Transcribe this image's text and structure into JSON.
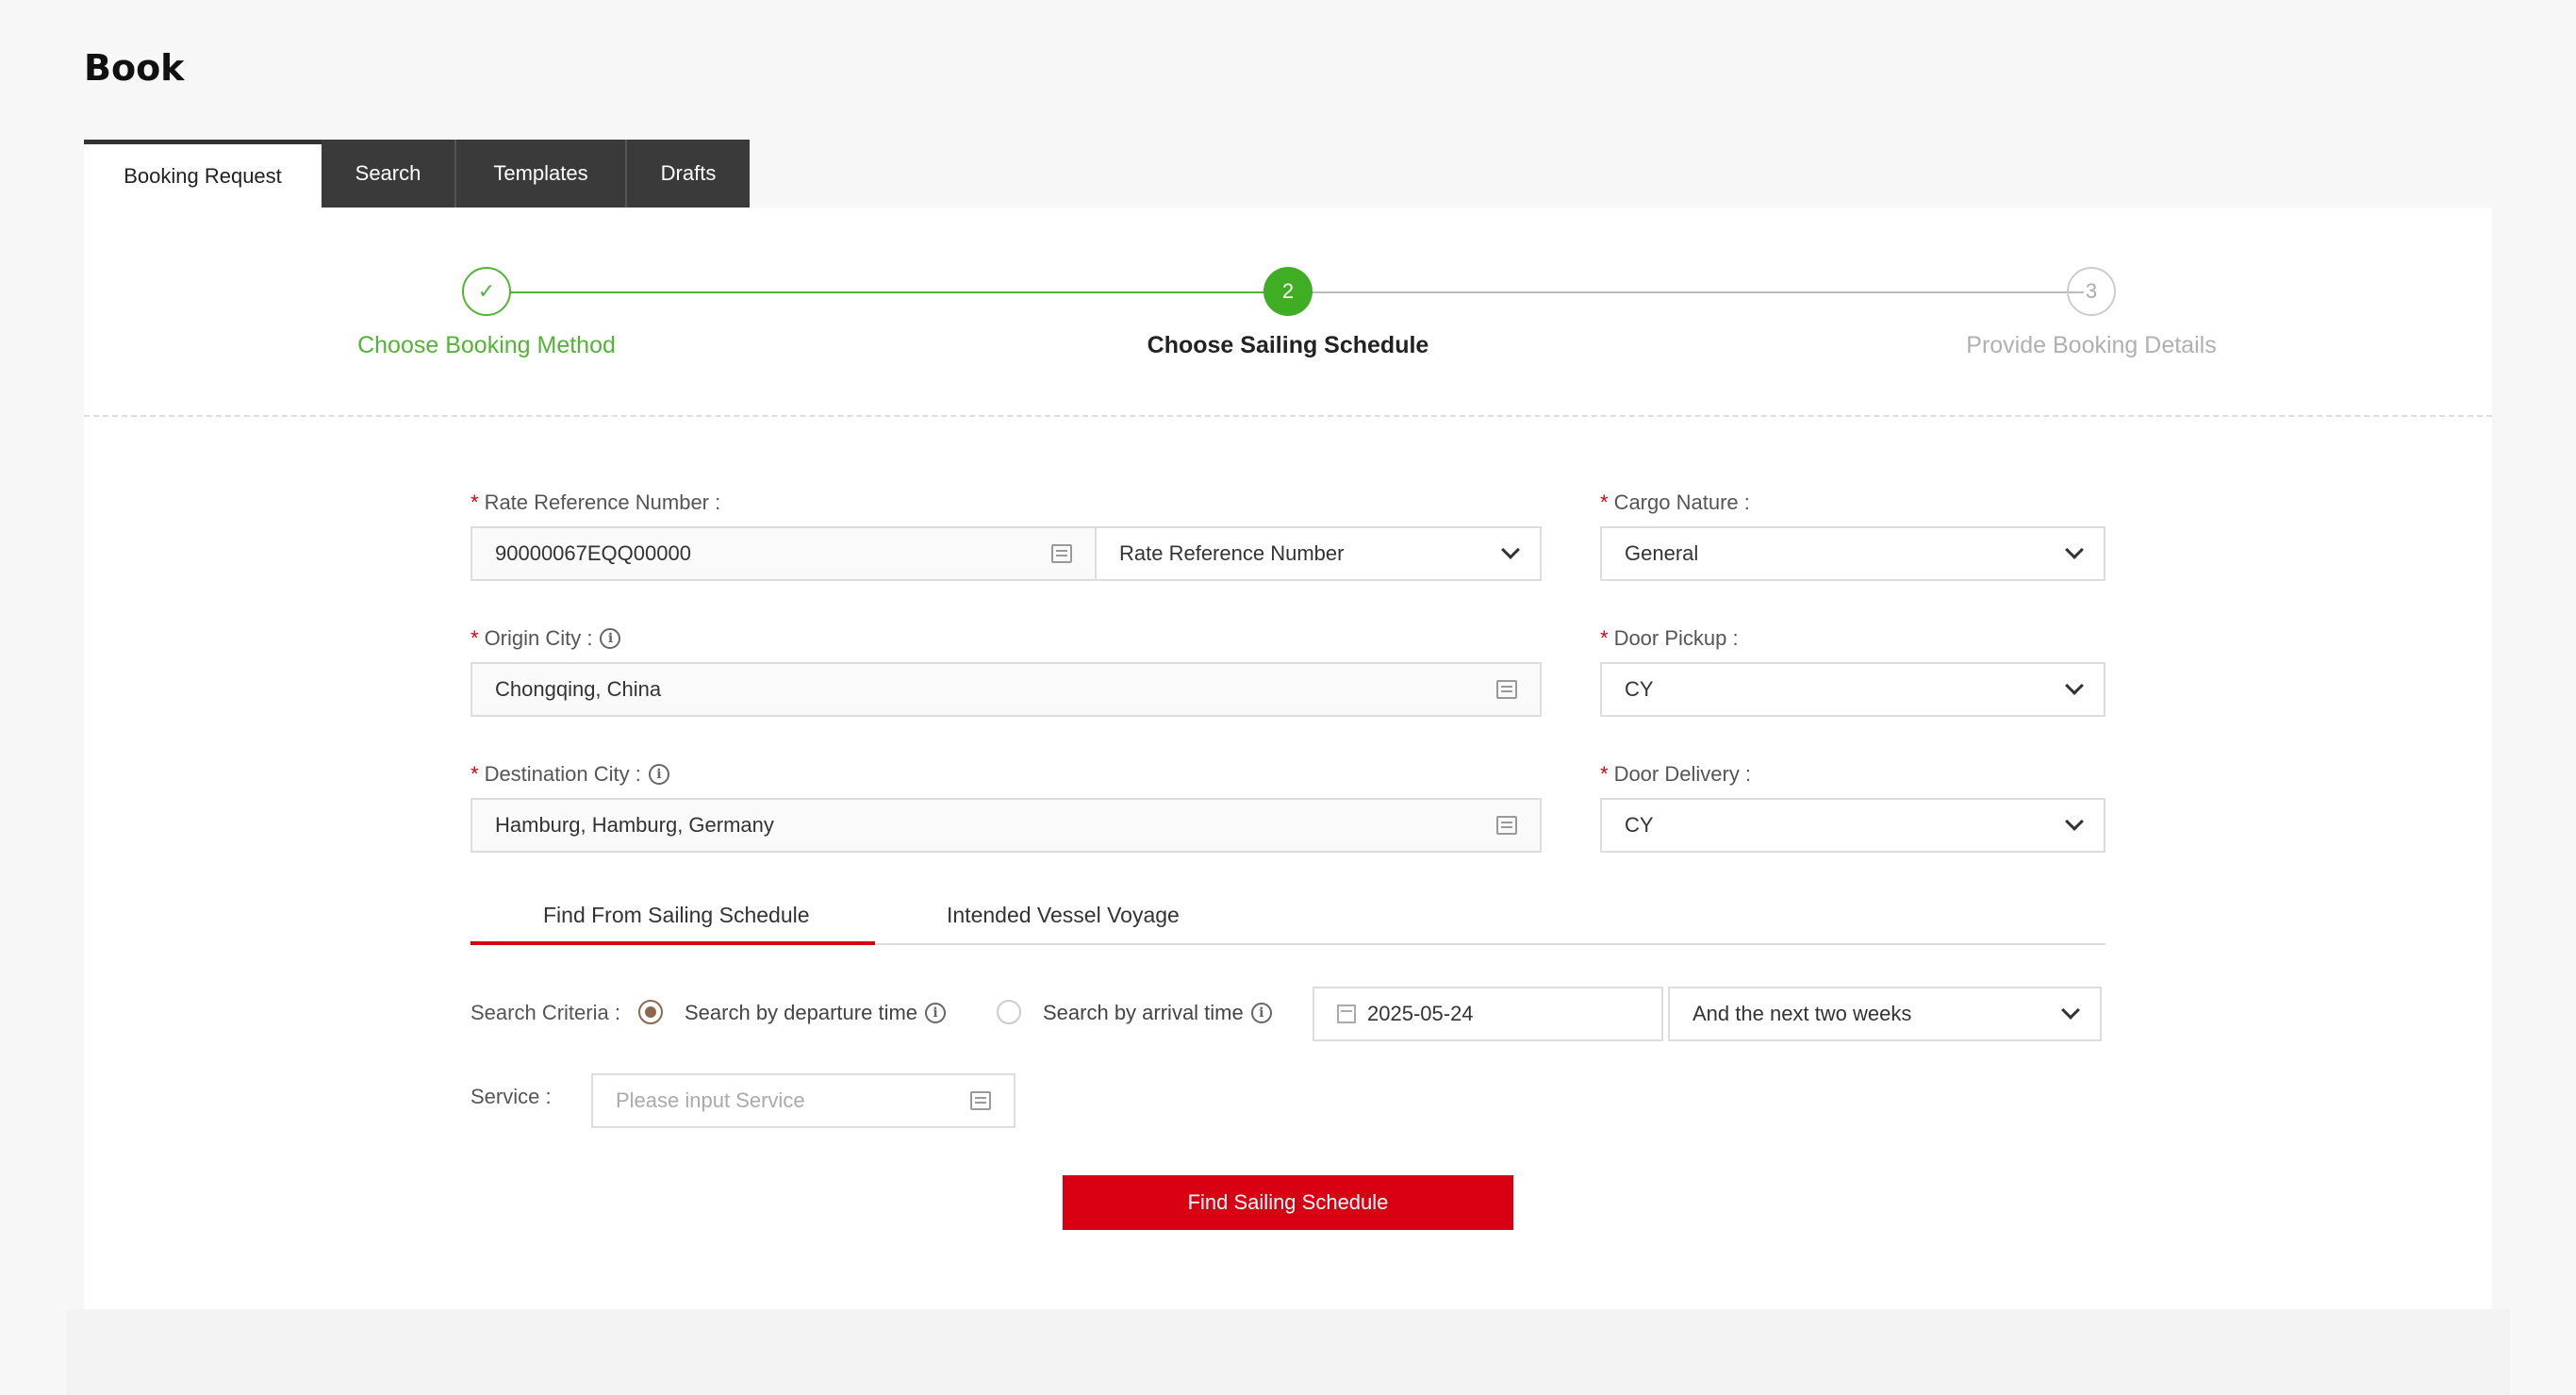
{
  "page": {
    "title": "Book"
  },
  "tabs": [
    {
      "label": "Booking Request"
    },
    {
      "label": "Search"
    },
    {
      "label": "Templates"
    },
    {
      "label": "Drafts"
    }
  ],
  "stepper": {
    "steps": [
      {
        "num": "✓",
        "label": "Choose Booking Method",
        "state": "done"
      },
      {
        "num": "2",
        "label": "Choose Sailing Schedule",
        "state": "active"
      },
      {
        "num": "3",
        "label": "Provide Booking Details",
        "state": "pending"
      }
    ]
  },
  "form": {
    "required_mark": "*",
    "rate_ref": {
      "label": "Rate Reference Number :",
      "value": "90000067EQQ00000",
      "type_value": "Rate Reference Number"
    },
    "origin": {
      "label": "Origin City :",
      "value": "Chongqing, China"
    },
    "destination": {
      "label": "Destination City :",
      "value": "Hamburg, Hamburg, Germany"
    },
    "cargo_nature": {
      "label": "Cargo Nature :",
      "value": "General"
    },
    "door_pickup": {
      "label": "Door Pickup :",
      "value": "CY"
    },
    "door_delivery": {
      "label": "Door Delivery :",
      "value": "CY"
    }
  },
  "inner_tabs": [
    {
      "label": "Find From Sailing Schedule"
    },
    {
      "label": "Intended Vessel Voyage"
    }
  ],
  "search": {
    "criteria_label": "Search Criteria :",
    "by_departure": "Search by departure time",
    "by_arrival": "Search by arrival time",
    "date": "2025-05-24",
    "range": "And the next two weeks",
    "service_label": "Service :",
    "service_placeholder": "Please input Service",
    "find_button": "Find Sailing Schedule"
  },
  "colors": {
    "accent": "#d80012",
    "success": "#52b435",
    "tab_dark": "#3a3a3a"
  }
}
